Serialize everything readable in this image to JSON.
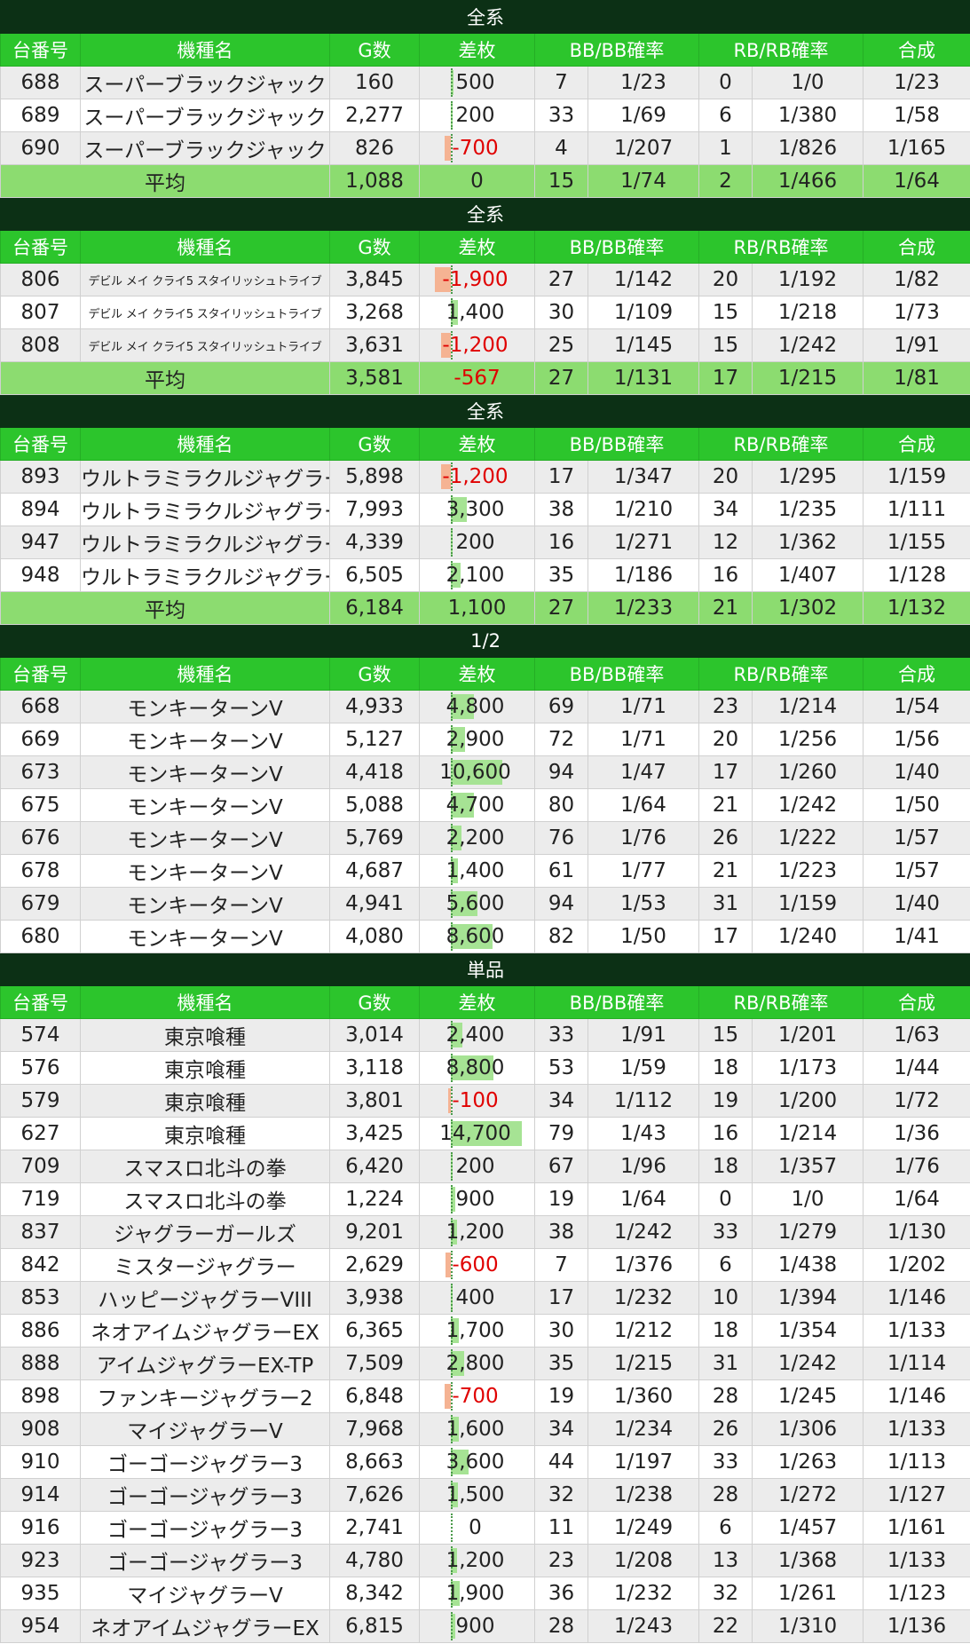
{
  "headers": {
    "unit": "台番号",
    "model": "機種名",
    "games": "G数",
    "diff": "差枚",
    "bb": "BB/BB確率",
    "rb": "RB/RB確率",
    "total": "合成"
  },
  "avg_label": "平均",
  "sections": [
    {
      "title": "全系",
      "rows": [
        {
          "unit": "688",
          "model": "スーパーブラックジャック",
          "games": "160",
          "diff": "500",
          "diff_value": 500,
          "bb": "7",
          "bb_prob": "1/23",
          "rb": "0",
          "rb_prob": "1/0",
          "total": "1/23"
        },
        {
          "unit": "689",
          "model": "スーパーブラックジャック",
          "games": "2,277",
          "diff": "200",
          "diff_value": 200,
          "bb": "33",
          "bb_prob": "1/69",
          "rb": "6",
          "rb_prob": "1/380",
          "total": "1/58"
        },
        {
          "unit": "690",
          "model": "スーパーブラックジャック",
          "games": "826",
          "diff": "-700",
          "diff_value": -700,
          "bb": "4",
          "bb_prob": "1/207",
          "rb": "1",
          "rb_prob": "1/826",
          "total": "1/165"
        }
      ],
      "average": {
        "games": "1,088",
        "diff": "0",
        "diff_value": 0,
        "bb": "15",
        "bb_prob": "1/74",
        "rb": "2",
        "rb_prob": "1/466",
        "total": "1/64"
      }
    },
    {
      "title": "全系",
      "small_model": true,
      "rows": [
        {
          "unit": "806",
          "model": "デビル メイ クライ5 スタイリッシュトライブ",
          "games": "3,845",
          "diff": "-1,900",
          "diff_value": -1900,
          "bb": "27",
          "bb_prob": "1/142",
          "rb": "20",
          "rb_prob": "1/192",
          "total": "1/82"
        },
        {
          "unit": "807",
          "model": "デビル メイ クライ5 スタイリッシュトライブ",
          "games": "3,268",
          "diff": "1,400",
          "diff_value": 1400,
          "bb": "30",
          "bb_prob": "1/109",
          "rb": "15",
          "rb_prob": "1/218",
          "total": "1/73"
        },
        {
          "unit": "808",
          "model": "デビル メイ クライ5 スタイリッシュトライブ",
          "games": "3,631",
          "diff": "-1,200",
          "diff_value": -1200,
          "bb": "25",
          "bb_prob": "1/145",
          "rb": "15",
          "rb_prob": "1/242",
          "total": "1/91"
        }
      ],
      "average": {
        "games": "3,581",
        "diff": "-567",
        "diff_value": -567,
        "bb": "27",
        "bb_prob": "1/131",
        "rb": "17",
        "rb_prob": "1/215",
        "total": "1/81"
      }
    },
    {
      "title": "全系",
      "rows": [
        {
          "unit": "893",
          "model": "ウルトラミラクルジャグラー",
          "games": "5,898",
          "diff": "-1,200",
          "diff_value": -1200,
          "bb": "17",
          "bb_prob": "1/347",
          "rb": "20",
          "rb_prob": "1/295",
          "total": "1/159"
        },
        {
          "unit": "894",
          "model": "ウルトラミラクルジャグラー",
          "games": "7,993",
          "diff": "3,300",
          "diff_value": 3300,
          "bb": "38",
          "bb_prob": "1/210",
          "rb": "34",
          "rb_prob": "1/235",
          "total": "1/111"
        },
        {
          "unit": "947",
          "model": "ウルトラミラクルジャグラー",
          "games": "4,339",
          "diff": "200",
          "diff_value": 200,
          "bb": "16",
          "bb_prob": "1/271",
          "rb": "12",
          "rb_prob": "1/362",
          "total": "1/155"
        },
        {
          "unit": "948",
          "model": "ウルトラミラクルジャグラー",
          "games": "6,505",
          "diff": "2,100",
          "diff_value": 2100,
          "bb": "35",
          "bb_prob": "1/186",
          "rb": "16",
          "rb_prob": "1/407",
          "total": "1/128"
        }
      ],
      "average": {
        "games": "6,184",
        "diff": "1,100",
        "diff_value": 1100,
        "bb": "27",
        "bb_prob": "1/233",
        "rb": "21",
        "rb_prob": "1/302",
        "total": "1/132"
      }
    },
    {
      "title": "1/2",
      "rows": [
        {
          "unit": "668",
          "model": "モンキーターンV",
          "games": "4,933",
          "diff": "4,800",
          "diff_value": 4800,
          "bb": "69",
          "bb_prob": "1/71",
          "rb": "23",
          "rb_prob": "1/214",
          "total": "1/54"
        },
        {
          "unit": "669",
          "model": "モンキーターンV",
          "games": "5,127",
          "diff": "2,900",
          "diff_value": 2900,
          "bb": "72",
          "bb_prob": "1/71",
          "rb": "20",
          "rb_prob": "1/256",
          "total": "1/56"
        },
        {
          "unit": "673",
          "model": "モンキーターンV",
          "games": "4,418",
          "diff": "10,600",
          "diff_value": 10600,
          "bb": "94",
          "bb_prob": "1/47",
          "rb": "17",
          "rb_prob": "1/260",
          "total": "1/40"
        },
        {
          "unit": "675",
          "model": "モンキーターンV",
          "games": "5,088",
          "diff": "4,700",
          "diff_value": 4700,
          "bb": "80",
          "bb_prob": "1/64",
          "rb": "21",
          "rb_prob": "1/242",
          "total": "1/50"
        },
        {
          "unit": "676",
          "model": "モンキーターンV",
          "games": "5,769",
          "diff": "2,200",
          "diff_value": 2200,
          "bb": "76",
          "bb_prob": "1/76",
          "rb": "26",
          "rb_prob": "1/222",
          "total": "1/57"
        },
        {
          "unit": "678",
          "model": "モンキーターンV",
          "games": "4,687",
          "diff": "1,400",
          "diff_value": 1400,
          "bb": "61",
          "bb_prob": "1/77",
          "rb": "21",
          "rb_prob": "1/223",
          "total": "1/57"
        },
        {
          "unit": "679",
          "model": "モンキーターンV",
          "games": "4,941",
          "diff": "5,600",
          "diff_value": 5600,
          "bb": "94",
          "bb_prob": "1/53",
          "rb": "31",
          "rb_prob": "1/159",
          "total": "1/40"
        },
        {
          "unit": "680",
          "model": "モンキーターンV",
          "games": "4,080",
          "diff": "8,600",
          "diff_value": 8600,
          "bb": "82",
          "bb_prob": "1/50",
          "rb": "17",
          "rb_prob": "1/240",
          "total": "1/41"
        }
      ]
    },
    {
      "title": "単品",
      "rows": [
        {
          "unit": "574",
          "model": "東京喰種",
          "games": "3,014",
          "diff": "2,400",
          "diff_value": 2400,
          "bb": "33",
          "bb_prob": "1/91",
          "rb": "15",
          "rb_prob": "1/201",
          "total": "1/63"
        },
        {
          "unit": "576",
          "model": "東京喰種",
          "games": "3,118",
          "diff": "8,800",
          "diff_value": 8800,
          "bb": "53",
          "bb_prob": "1/59",
          "rb": "18",
          "rb_prob": "1/173",
          "total": "1/44"
        },
        {
          "unit": "579",
          "model": "東京喰種",
          "games": "3,801",
          "diff": "-100",
          "diff_value": -100,
          "bb": "34",
          "bb_prob": "1/112",
          "rb": "19",
          "rb_prob": "1/200",
          "total": "1/72"
        },
        {
          "unit": "627",
          "model": "東京喰種",
          "games": "3,425",
          "diff": "14,700",
          "diff_value": 14700,
          "bb": "79",
          "bb_prob": "1/43",
          "rb": "16",
          "rb_prob": "1/214",
          "total": "1/36"
        },
        {
          "unit": "709",
          "model": "スマスロ北斗の拳",
          "games": "6,420",
          "diff": "200",
          "diff_value": 200,
          "bb": "67",
          "bb_prob": "1/96",
          "rb": "18",
          "rb_prob": "1/357",
          "total": "1/76"
        },
        {
          "unit": "719",
          "model": "スマスロ北斗の拳",
          "games": "1,224",
          "diff": "900",
          "diff_value": 900,
          "bb": "19",
          "bb_prob": "1/64",
          "rb": "0",
          "rb_prob": "1/0",
          "total": "1/64"
        },
        {
          "unit": "837",
          "model": "ジャグラーガールズ",
          "games": "9,201",
          "diff": "1,200",
          "diff_value": 1200,
          "bb": "38",
          "bb_prob": "1/242",
          "rb": "33",
          "rb_prob": "1/279",
          "total": "1/130"
        },
        {
          "unit": "842",
          "model": "ミスタージャグラー",
          "games": "2,629",
          "diff": "-600",
          "diff_value": -600,
          "bb": "7",
          "bb_prob": "1/376",
          "rb": "6",
          "rb_prob": "1/438",
          "total": "1/202"
        },
        {
          "unit": "853",
          "model": "ハッピージャグラーVIII",
          "games": "3,938",
          "diff": "400",
          "diff_value": 400,
          "bb": "17",
          "bb_prob": "1/232",
          "rb": "10",
          "rb_prob": "1/394",
          "total": "1/146"
        },
        {
          "unit": "886",
          "model": "ネオアイムジャグラーEX",
          "games": "6,365",
          "diff": "1,700",
          "diff_value": 1700,
          "bb": "30",
          "bb_prob": "1/212",
          "rb": "18",
          "rb_prob": "1/354",
          "total": "1/133"
        },
        {
          "unit": "888",
          "model": "アイムジャグラーEX-TP",
          "games": "7,509",
          "diff": "2,800",
          "diff_value": 2800,
          "bb": "35",
          "bb_prob": "1/215",
          "rb": "31",
          "rb_prob": "1/242",
          "total": "1/114"
        },
        {
          "unit": "898",
          "model": "ファンキージャグラー2",
          "games": "6,848",
          "diff": "-700",
          "diff_value": -700,
          "bb": "19",
          "bb_prob": "1/360",
          "rb": "28",
          "rb_prob": "1/245",
          "total": "1/146"
        },
        {
          "unit": "908",
          "model": "マイジャグラーV",
          "games": "7,968",
          "diff": "1,600",
          "diff_value": 1600,
          "bb": "34",
          "bb_prob": "1/234",
          "rb": "26",
          "rb_prob": "1/306",
          "total": "1/133"
        },
        {
          "unit": "910",
          "model": "ゴーゴージャグラー3",
          "games": "8,663",
          "diff": "3,600",
          "diff_value": 3600,
          "bb": "44",
          "bb_prob": "1/197",
          "rb": "33",
          "rb_prob": "1/263",
          "total": "1/113"
        },
        {
          "unit": "914",
          "model": "ゴーゴージャグラー3",
          "games": "7,626",
          "diff": "1,500",
          "diff_value": 1500,
          "bb": "32",
          "bb_prob": "1/238",
          "rb": "28",
          "rb_prob": "1/272",
          "total": "1/127"
        },
        {
          "unit": "916",
          "model": "ゴーゴージャグラー3",
          "games": "2,741",
          "diff": "0",
          "diff_value": 0,
          "bb": "11",
          "bb_prob": "1/249",
          "rb": "6",
          "rb_prob": "1/457",
          "total": "1/161"
        },
        {
          "unit": "923",
          "model": "ゴーゴージャグラー3",
          "games": "4,780",
          "diff": "1,200",
          "diff_value": 1200,
          "bb": "23",
          "bb_prob": "1/208",
          "rb": "13",
          "rb_prob": "1/368",
          "total": "1/133"
        },
        {
          "unit": "935",
          "model": "マイジャグラーV",
          "games": "8,342",
          "diff": "1,900",
          "diff_value": 1900,
          "bb": "36",
          "bb_prob": "1/232",
          "rb": "32",
          "rb_prob": "1/261",
          "total": "1/123"
        },
        {
          "unit": "954",
          "model": "ネオアイムジャグラーEX",
          "games": "6,815",
          "diff": "900",
          "diff_value": 900,
          "bb": "28",
          "bb_prob": "1/243",
          "rb": "22",
          "rb_prob": "1/310",
          "total": "1/136"
        }
      ]
    }
  ]
}
